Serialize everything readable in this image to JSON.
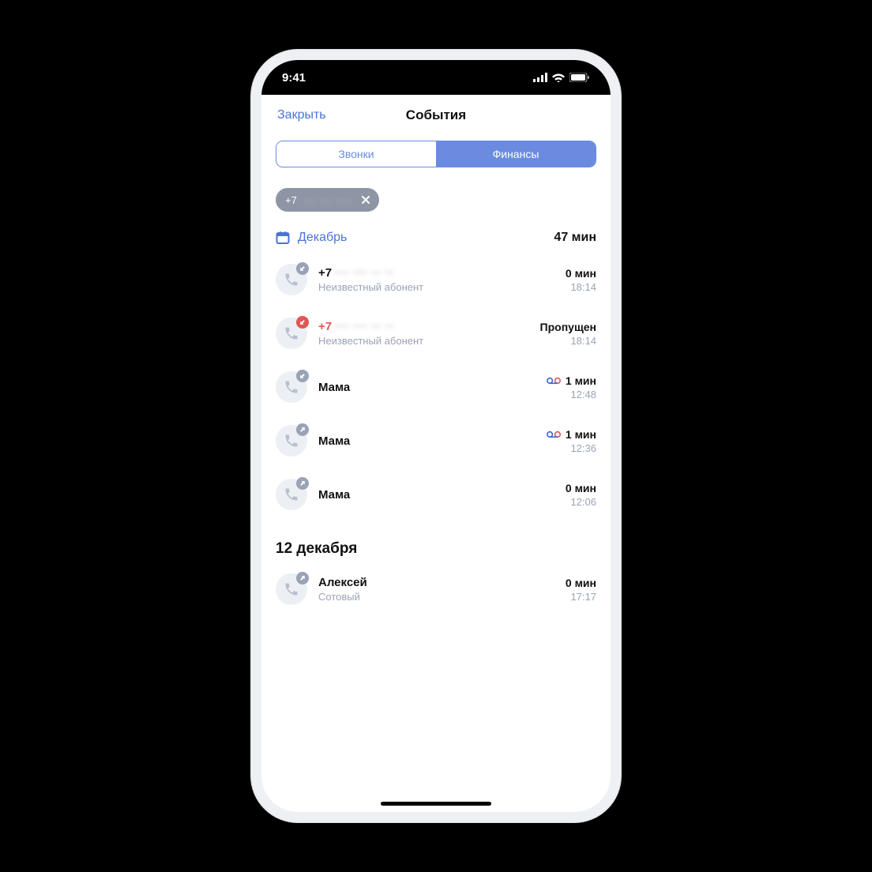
{
  "status": {
    "time": "9:41"
  },
  "nav": {
    "close": "Закрыть",
    "title": "События"
  },
  "segmented": {
    "calls": "Звонки",
    "finance": "Финансы"
  },
  "filter_chip": {
    "prefix": "+7",
    "rest": "··· ··· ····"
  },
  "month": {
    "label": "Декабрь",
    "total": "47 мин"
  },
  "calls": [
    {
      "name_prefix": "+7",
      "name_blur": true,
      "sub": "Неизвестный абонент",
      "dir": "in",
      "missed": false,
      "dur": "0 мин",
      "time": "18:14",
      "voicemail": false
    },
    {
      "name_prefix": "+7",
      "name_blur": true,
      "sub": "Неизвестный абонент",
      "dir": "in",
      "missed": true,
      "dur": "Пропущен",
      "time": "18:14",
      "voicemail": false
    },
    {
      "name": "Мама",
      "sub": "",
      "dir": "in",
      "missed": false,
      "dur": "1 мин",
      "time": "12:48",
      "voicemail": true
    },
    {
      "name": "Мама",
      "sub": "",
      "dir": "out",
      "missed": false,
      "dur": "1 мин",
      "time": "12:36",
      "voicemail": true
    },
    {
      "name": "Мама",
      "sub": "",
      "dir": "out",
      "missed": false,
      "dur": "0 мин",
      "time": "12:06",
      "voicemail": false
    }
  ],
  "section2": {
    "header": "12 декабря"
  },
  "calls2": [
    {
      "name": "Алексей",
      "sub": "Сотовый",
      "dir": "out",
      "missed": false,
      "dur": "0 мин",
      "time": "17:17",
      "voicemail": false
    }
  ]
}
